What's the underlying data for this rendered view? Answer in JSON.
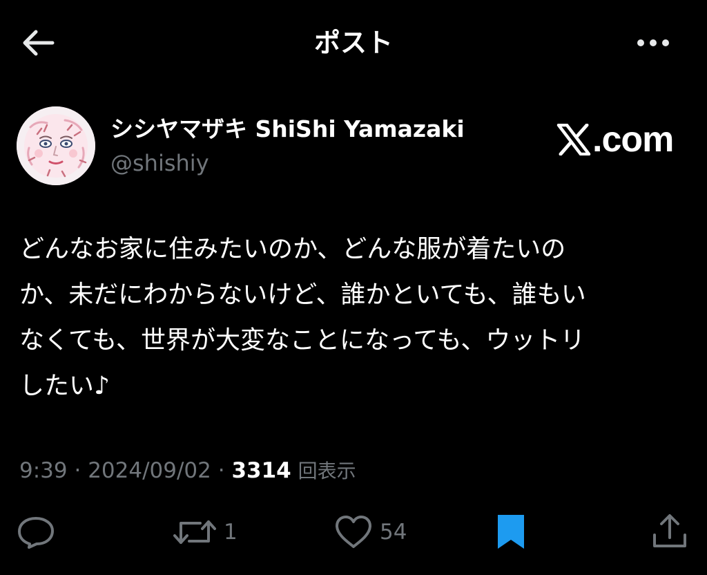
{
  "header": {
    "title": "ポスト",
    "back_icon": "arrow-left-icon",
    "more_icon": "more-horizontal-icon"
  },
  "author": {
    "display_name": "シシヤマザキ ShiShi Yamazaki",
    "handle": "@shishiy",
    "avatar": "avatar-illustration"
  },
  "watermark": {
    "text": ".com",
    "icon": "x-logo-icon"
  },
  "post": {
    "lines": [
      "どんなお家に住みたいのか、どんな服が着たいの",
      "か、未だにわからないけど、誰かといても、誰もい",
      "なくても、世界が大変なことになっても、ウットリ",
      "したい♪"
    ]
  },
  "meta": {
    "time": "9:39",
    "separator": " · ",
    "date": "2024/09/02",
    "views_count": "3314",
    "views_label": "回表示"
  },
  "actions": {
    "reply": {
      "icon": "reply-icon",
      "count": ""
    },
    "repost": {
      "icon": "repost-icon",
      "count": "1"
    },
    "like": {
      "icon": "heart-icon",
      "count": "54"
    },
    "bookmark": {
      "icon": "bookmark-icon",
      "active": true
    },
    "share": {
      "icon": "share-icon"
    }
  },
  "colors": {
    "background": "#000000",
    "text_primary": "#ffffff",
    "text_secondary": "#71767b",
    "bookmark_active": "#1d9bf0"
  }
}
